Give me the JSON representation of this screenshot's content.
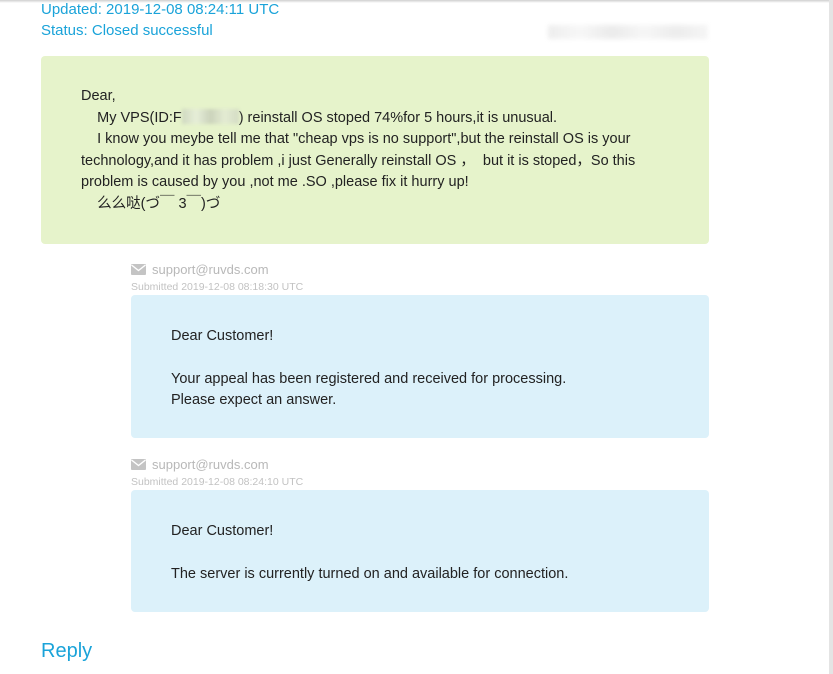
{
  "ticket": {
    "updated": "Updated: 2019-12-08 08:24:11 UTC",
    "status": "Status: Closed successful"
  },
  "customer_message": {
    "line1": "Dear,",
    "line2_before": "    My VPS(ID:F",
    "line2_after": ") reinstall OS stoped 74%for 5 hours,it is unusual.",
    "paragraph": "    I know you meybe tell me that \"cheap vps is no support\",but the reinstall OS is your technology,and it has problem ,i just Generally reinstall OS ，  but it is stoped，So this problem is caused by you ,not me .SO ,please fix it hurry up!",
    "sign": "    么么哒(づ￣ 3￣)づ"
  },
  "replies": [
    {
      "sender": "support@ruvds.com",
      "submitted": "Submitted 2019-12-08 08:18:30 UTC",
      "greeting": "Dear Customer!",
      "body_line1": "Your appeal has been registered and received for processing.",
      "body_line2": "Please expect an answer."
    },
    {
      "sender": "support@ruvds.com",
      "submitted": "Submitted 2019-12-08 08:24:10 UTC",
      "greeting": "Dear Customer!",
      "body_line1": "The server is currently turned on and available for connection."
    }
  ],
  "actions": {
    "reply_label": "Reply"
  },
  "icons": {
    "sender_icon": "envelope-icon"
  },
  "colors": {
    "accent": "#1aa3d9",
    "customer_bg": "#e6f3cb",
    "support_bg": "#dcf1fa"
  }
}
